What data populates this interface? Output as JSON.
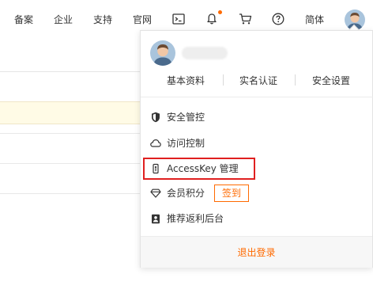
{
  "topnav": {
    "items": [
      "备案",
      "企业",
      "支持",
      "官网"
    ],
    "lang": "简体"
  },
  "account": {
    "links": [
      "基本资料",
      "实名认证",
      "安全设置"
    ]
  },
  "menu": {
    "items": [
      {
        "label": "安全管控",
        "icon": "shield-icon"
      },
      {
        "label": "访问控制",
        "icon": "cloud-icon"
      },
      {
        "label": "AccessKey 管理",
        "icon": "key-icon"
      },
      {
        "label": "会员积分",
        "icon": "diamond-icon"
      },
      {
        "label": "推荐返利后台",
        "icon": "contact-card-icon"
      }
    ],
    "signin_badge": "签到",
    "logout": "退出登录"
  },
  "colors": {
    "accent": "#ff6a00",
    "highlight": "#e02020",
    "notice_bg": "#fffbe6"
  }
}
